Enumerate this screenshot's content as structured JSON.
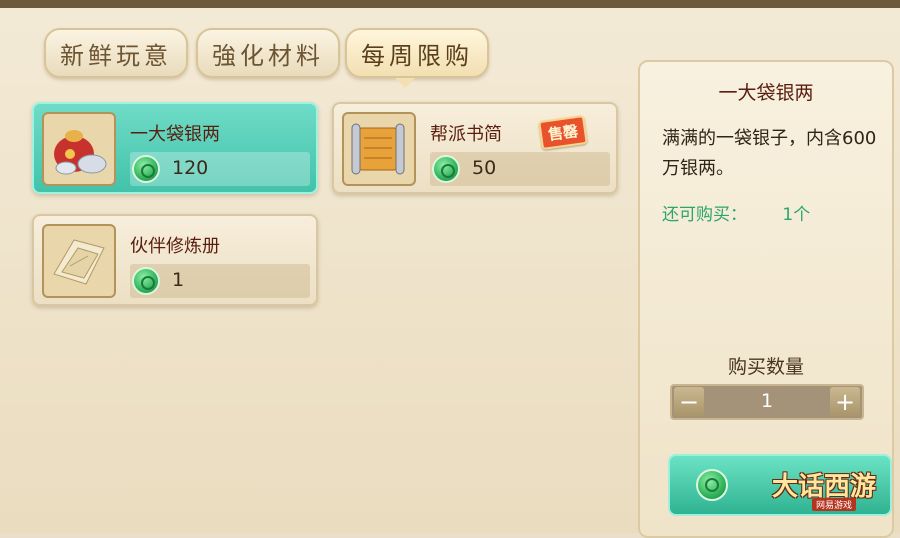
{
  "tabs": [
    {
      "label": "新鲜玩意",
      "active": false
    },
    {
      "label": "強化材料",
      "active": false
    },
    {
      "label": "每周限购",
      "active": true
    }
  ],
  "items": [
    {
      "name": "一大袋银两",
      "price": "120",
      "selected": true,
      "icon": "silver-bag-icon"
    },
    {
      "name": "帮派书简",
      "price": "50",
      "selected": false,
      "badge": "售罄",
      "icon": "scroll-icon"
    },
    {
      "name": "伙伴修炼册",
      "price": "1",
      "selected": false,
      "icon": "training-book-icon"
    }
  ],
  "detail": {
    "title": "一大袋银两",
    "description": "满满的一袋银子，内含600万银两。",
    "remain_label": "还可购买：",
    "remain_count": "1个"
  },
  "quantity": {
    "label": "购买数量",
    "value": "1",
    "minus": "−",
    "plus": "+"
  },
  "buy_button": {
    "icon": "jade-coin-icon",
    "logo_main": "大话西游",
    "logo_sub": "网易游戏"
  },
  "colors": {
    "selected_card": "#43c2aa",
    "item_name": "#5a1e0e",
    "remain_text": "#2aa66a",
    "sale_badge": "#e8522d"
  }
}
